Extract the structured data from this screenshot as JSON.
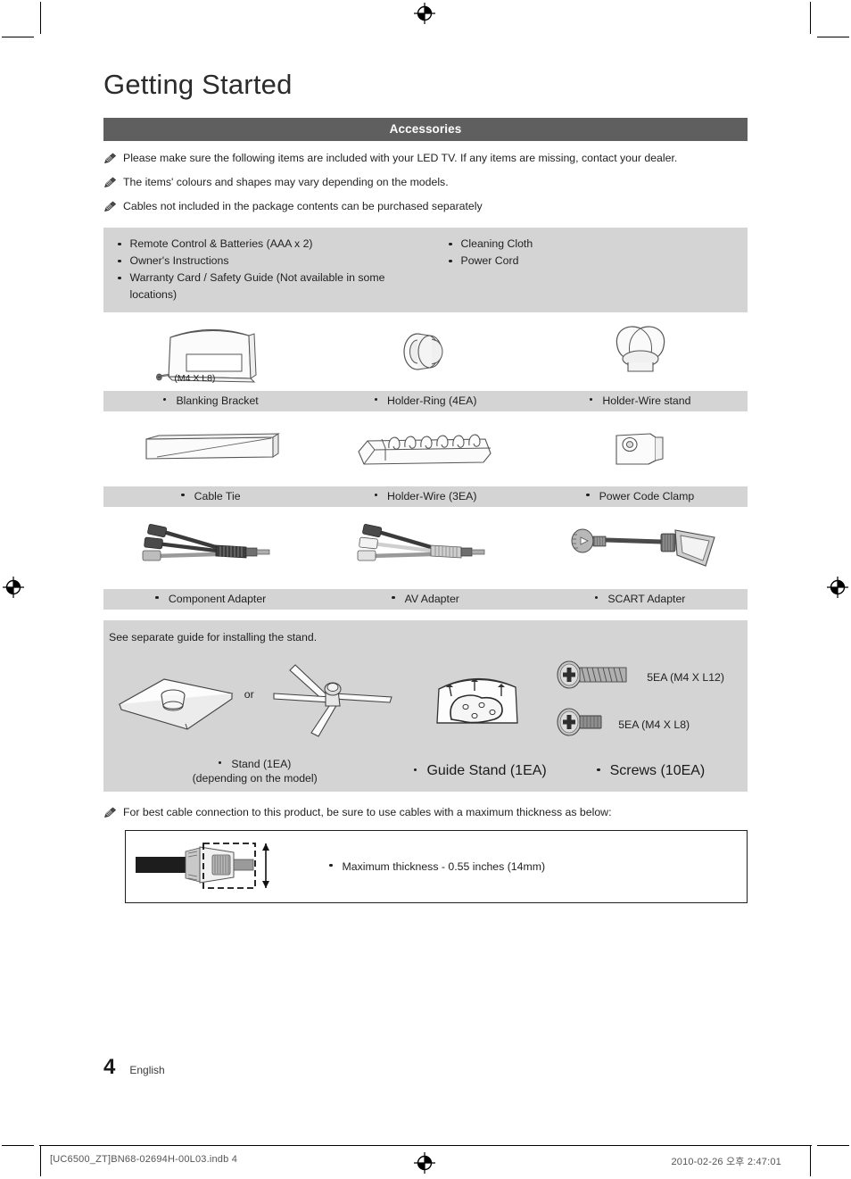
{
  "document": {
    "title": "Getting Started",
    "section_heading": "Accessories",
    "page_number": "4",
    "language": "English",
    "imprint": "[UC6500_ZT]BN68-02694H-00L03.indb   4",
    "print_stamp": "2010-02-26   오후 2:47:01"
  },
  "notes": [
    {
      "icon": "pencil-note-icon",
      "text": "Please make sure the following items are included with your LED TV. If any items are missing, contact your dealer."
    },
    {
      "icon": "pencil-note-icon",
      "text": "The items' colours and shapes may vary depending on the models."
    },
    {
      "icon": "pencil-note-icon",
      "text": "Cables not included in the package contents can be purchased separately"
    }
  ],
  "included_items": {
    "left": [
      "Remote Control & Batteries (AAA x 2)",
      "Owner's Instructions",
      "Warranty Card / Safety Guide (Not available in some locations)"
    ],
    "right": [
      "Cleaning Cloth",
      "Power Cord"
    ]
  },
  "accessory_rows": [
    {
      "items": [
        {
          "label": "Blanking Bracket",
          "icon": "blanking-bracket-icon",
          "annotation": "(M4 X L8)",
          "annotation_icon": "screw-small-icon"
        },
        {
          "label": "Holder-Ring (4EA)",
          "icon": "holder-ring-icon"
        },
        {
          "label": "Holder-Wire stand",
          "icon": "holder-wire-stand-icon"
        }
      ]
    },
    {
      "items": [
        {
          "label": "Cable Tie",
          "icon": "cable-tie-icon"
        },
        {
          "label": "Holder-Wire (3EA)",
          "icon": "holder-wire-icon"
        },
        {
          "label": "Power Code Clamp",
          "icon": "power-code-clamp-icon"
        }
      ]
    },
    {
      "items": [
        {
          "label": "Component Adapter",
          "icon": "component-adapter-icon"
        },
        {
          "label": "AV Adapter",
          "icon": "av-adapter-icon"
        },
        {
          "label": "SCART Adapter",
          "icon": "scart-adapter-icon"
        }
      ]
    }
  ],
  "stand_section": {
    "note": "See separate guide for installing the stand.",
    "or_label": "or",
    "stand_label": "Stand (1EA)",
    "stand_sublabel": "(depending on the model)",
    "guide_stand_label": "Guide Stand (1EA)",
    "screws_label": "Screws (10EA)",
    "screws": [
      {
        "text": "5EA (M4 X L12)",
        "icon": "screw-long-icon"
      },
      {
        "text": "5EA (M4 X L8)",
        "icon": "screw-short-icon"
      }
    ]
  },
  "cable_section": {
    "note": "For best cable connection to this product, be sure to use cables with a maximum thickness as below:",
    "spec": "Maximum thickness - 0.55 inches (14mm)",
    "icon": "cable-connector-icon"
  },
  "colors": {
    "section_bar": "#5f5f5f",
    "panel_gray": "#d4d4d4",
    "text": "#1f1f1f",
    "page_bg": "#ffffff"
  }
}
